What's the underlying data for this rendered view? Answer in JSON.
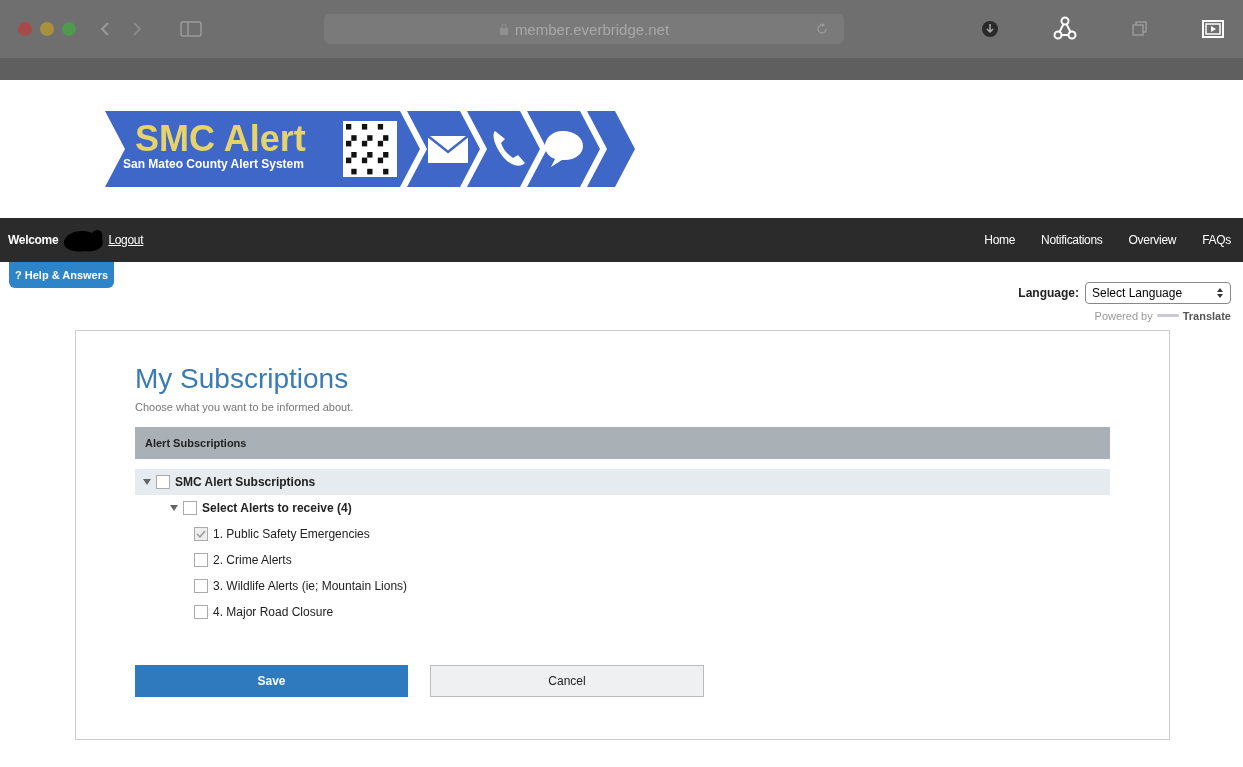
{
  "browser": {
    "url": "member.everbridge.net"
  },
  "logo": {
    "title": "SMC Alert",
    "subtitle": "San Mateo County Alert System"
  },
  "navbar": {
    "welcome": "Welcome",
    "logout": "Logout",
    "links": [
      "Home",
      "Notifications",
      "Overview",
      "FAQs"
    ]
  },
  "help_button": {
    "icon": "?",
    "label": "Help & Answers"
  },
  "language": {
    "label": "Language:",
    "select": "Select Language",
    "powered_by": "Powered by",
    "translate": "Translate"
  },
  "page": {
    "title": "My Subscriptions",
    "subtitle": "Choose what you want to be informed about."
  },
  "section": {
    "title": "Alert Subscriptions"
  },
  "tree": [
    {
      "label": "SMC Alert Subscriptions",
      "checked": false,
      "expanded": true,
      "children": [
        {
          "label": "Select Alerts to receive (4)",
          "checked": false,
          "expanded": true,
          "children": [
            {
              "label": "1. Public Safety Emergencies",
              "checked": true
            },
            {
              "label": "2. Crime Alerts",
              "checked": false
            },
            {
              "label": "3. Wildlife Alerts (ie; Mountain Lions)",
              "checked": false
            },
            {
              "label": "4. Major Road Closure",
              "checked": false
            }
          ]
        }
      ]
    }
  ],
  "buttons": {
    "save": "Save",
    "cancel": "Cancel"
  }
}
